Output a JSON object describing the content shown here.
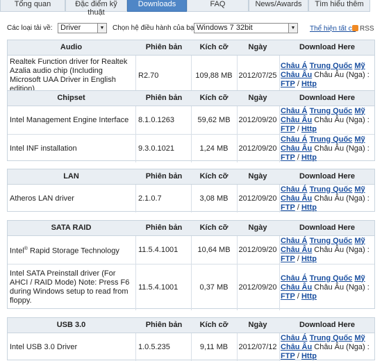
{
  "tabs": [
    {
      "label": "Tổng quan"
    },
    {
      "label": "Đặc điểm kỹ thuật"
    },
    {
      "label": "Downloads"
    },
    {
      "label": "FAQ"
    },
    {
      "label": "News/Awards"
    },
    {
      "label": "Tìm hiểu thêm"
    }
  ],
  "filter": {
    "type_label": "Các loại tải về:",
    "type_value": "Driver",
    "os_label": "Chọn hệ điều hành của bạn:",
    "os_value": "Windows 7 32bit",
    "show_all": "Thể hiện tất cả",
    "rss": "RSS"
  },
  "headers": {
    "version": "Phiên bản",
    "size": "Kích cỡ",
    "date": "Ngày",
    "download": "Download Here"
  },
  "download_links": {
    "asia": "Châu Á",
    "china": "Trung Quốc",
    "america": "Mỹ",
    "europe": "Châu Âu",
    "europe_plain": "Châu Âu (Nga) :",
    "ftp": "FTP",
    "sep": "/",
    "http": "Http"
  },
  "sections": [
    {
      "title": "Audio",
      "rows": [
        {
          "name": "Realtek Function driver for Realtek Azalia audio chip (Including Microsoft UAA Driver in English edition)",
          "version": "R2.70",
          "size": "109,88 MB",
          "date": "2012/07/25"
        }
      ]
    },
    {
      "title": "Chipset",
      "rows": [
        {
          "name": "Intel Management Engine Interface",
          "version": "8.1.0.1263",
          "size": "59,62 MB",
          "date": "2012/09/20"
        },
        {
          "name": "Intel INF installation",
          "version": "9.3.0.1021",
          "size": "1,24 MB",
          "date": "2012/09/20"
        }
      ]
    },
    {
      "title": "LAN",
      "rows": [
        {
          "name": "Atheros LAN driver",
          "version": "2.1.0.7",
          "size": "3,08 MB",
          "date": "2012/09/20"
        }
      ]
    },
    {
      "title": "SATA RAID",
      "rows": [
        {
          "name_pre": "Intel",
          "name_sup": "®",
          "name_post": " Rapid Storage Technology",
          "version": "11.5.4.1001",
          "size": "10,64 MB",
          "date": "2012/09/20"
        },
        {
          "name": "Intel SATA Preinstall driver (For AHCI / RAID Mode) Note: Press F6 during Windows setup to read from floppy.",
          "version": "11.5.4.1001",
          "size": "0,37 MB",
          "date": "2012/09/20"
        }
      ]
    },
    {
      "title": "USB 3.0",
      "rows": [
        {
          "name": "Intel USB 3.0 Driver",
          "version": "1.0.5.235",
          "size": "9,11 MB",
          "date": "2012/07/12"
        }
      ]
    }
  ]
}
